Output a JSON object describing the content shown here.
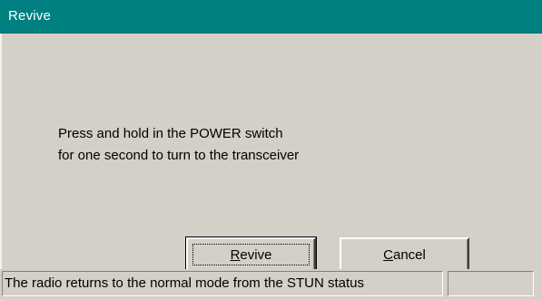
{
  "window": {
    "title": "Revive"
  },
  "message": {
    "line1": "Press and hold in the POWER switch",
    "line2": "for one second to turn to the transceiver"
  },
  "buttons": {
    "revive": {
      "mnemonic": "R",
      "rest": "evive"
    },
    "cancel": {
      "mnemonic": "C",
      "rest": "ancel"
    }
  },
  "statusbar": {
    "main_text": "The radio returns to the normal mode from the STUN status",
    "side_text": ""
  },
  "colors": {
    "titlebar": "#008080",
    "face": "#d4d0c8",
    "title_text": "#ffffff"
  }
}
